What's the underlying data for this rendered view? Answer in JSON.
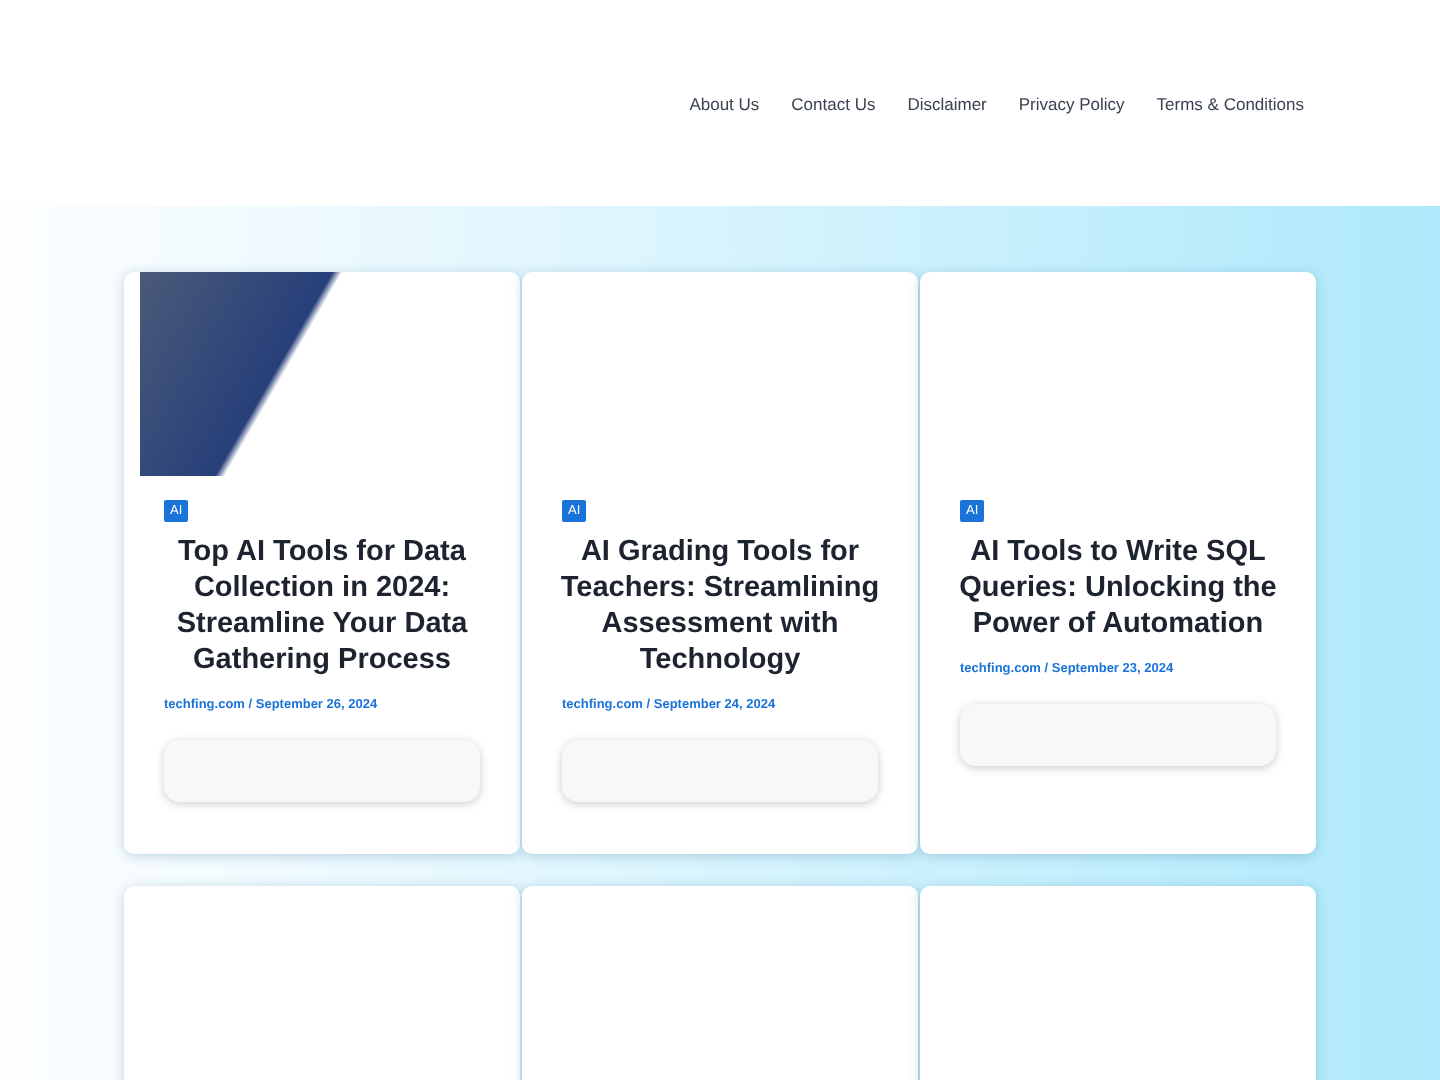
{
  "nav": [
    "About Us",
    "Contact Us",
    "Disclaimer",
    "Privacy Policy",
    "Terms & Conditions"
  ],
  "posts": [
    {
      "has_image": true,
      "category": "AI",
      "title": "Top AI Tools for Data Collection in 2024: Streamline Your Data Gathering Process",
      "meta": "techfing.com / September 26, 2024"
    },
    {
      "has_image": false,
      "category": "AI",
      "title": "AI Grading Tools for Teachers: Streamlining Assessment with Technology",
      "meta": "techfing.com / September 24, 2024"
    },
    {
      "has_image": false,
      "category": "AI",
      "title": "AI Tools to Write SQL Queries: Unlocking the Power of Automation",
      "meta": "techfing.com / September 23, 2024"
    }
  ],
  "more_posts": [
    {
      "kind": "blank"
    },
    {
      "kind": "blank"
    },
    {
      "kind": "blank"
    }
  ]
}
